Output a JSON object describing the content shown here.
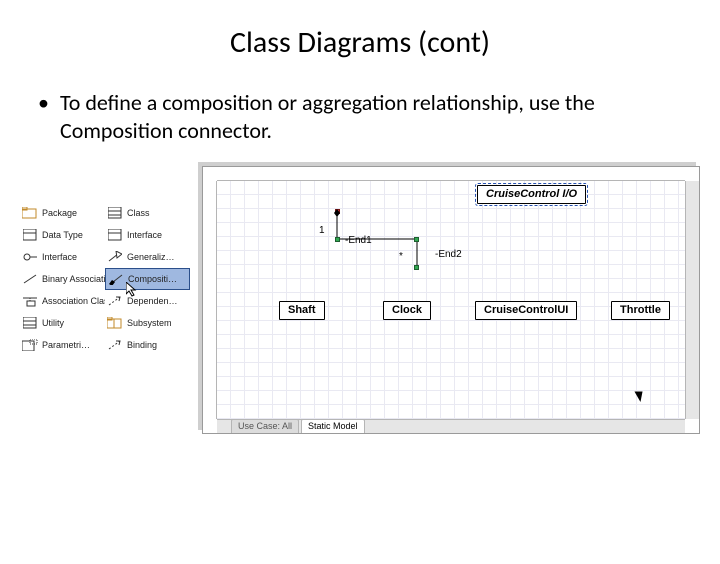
{
  "title": "Class Diagrams (cont)",
  "bullet": "To define a composition or aggregation relationship, use the Composition connector.",
  "palette": {
    "rows": [
      {
        "left": {
          "icon": "package",
          "label": "Package"
        },
        "right": {
          "icon": "class",
          "label": "Class"
        }
      },
      {
        "left": {
          "icon": "datatype",
          "label": "Data Type"
        },
        "right": {
          "icon": "interface",
          "label": "Interface"
        }
      },
      {
        "left": {
          "icon": "interface2",
          "label": "Interface"
        },
        "right": {
          "icon": "generalization",
          "label": "Generaliz…"
        }
      },
      {
        "left": {
          "icon": "assoc",
          "label": "Binary Association"
        },
        "right": {
          "icon": "composition",
          "label": "Compositi…",
          "selected": true
        }
      },
      {
        "left": {
          "icon": "assoc-class",
          "label": "Association Class"
        },
        "right": {
          "icon": "dependency",
          "label": "Dependen…"
        }
      },
      {
        "left": {
          "icon": "utility",
          "label": "Utility"
        },
        "right": {
          "icon": "subsystem",
          "label": "Subsystem"
        }
      },
      {
        "left": {
          "icon": "param-class",
          "label": "Parametri…"
        },
        "right": {
          "icon": "binding",
          "label": "Binding"
        }
      }
    ]
  },
  "canvas": {
    "title_box": "CruiseControl I/O",
    "end_labels": {
      "one": "1",
      "end1": "-End1",
      "star": "*",
      "end2": "-End2"
    },
    "classes": [
      "Shaft",
      "Clock",
      "CruiseControlUI",
      "Throttle"
    ],
    "tabs": {
      "inactive": "Use Case: All",
      "active": "Static Model"
    }
  }
}
